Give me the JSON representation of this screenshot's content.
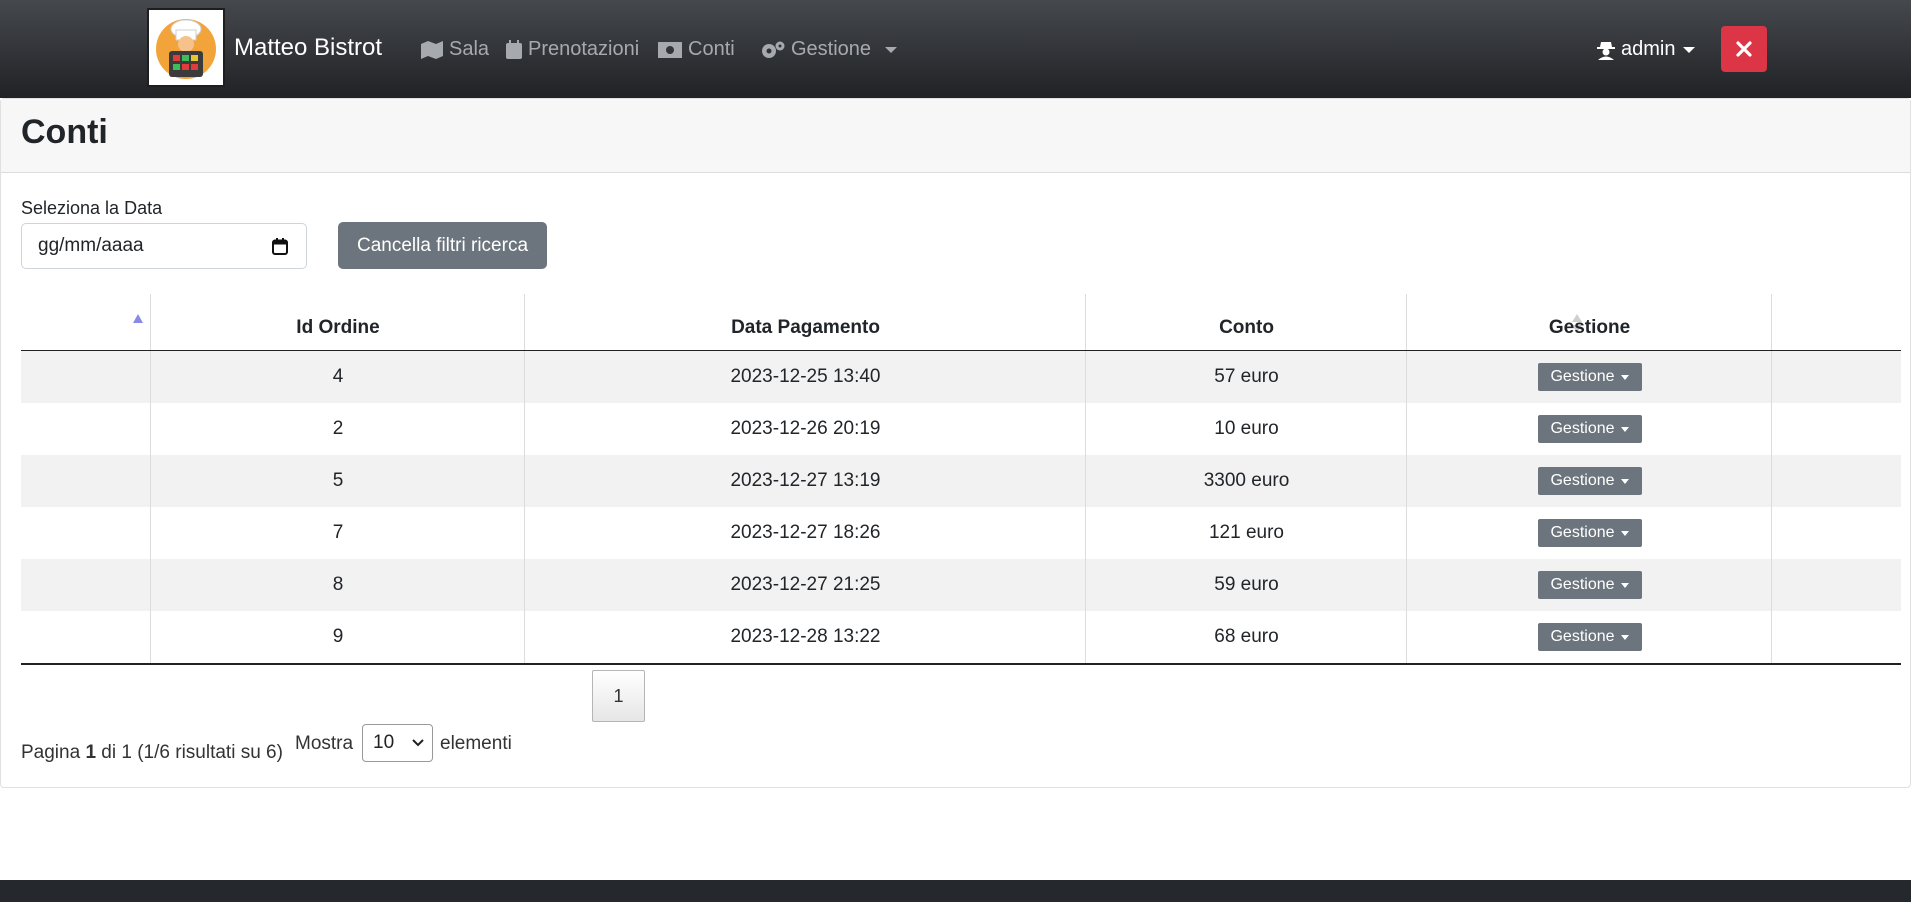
{
  "navbar": {
    "brand": "Matteo Bistrot",
    "links": [
      {
        "label": "Sala",
        "icon": "map-icon"
      },
      {
        "label": "Prenotazioni",
        "icon": "calendar-icon"
      },
      {
        "label": "Conti",
        "icon": "money-bill-icon"
      },
      {
        "label": "Gestione",
        "icon": "gears-icon"
      }
    ],
    "user": "admin",
    "close_symbol": "✕"
  },
  "page": {
    "title": "Conti"
  },
  "filters": {
    "date_label": "Seleziona la Data",
    "date_placeholder": "gg/mm/aaaa",
    "clear_button": "Cancella filtri ricerca"
  },
  "table": {
    "headers": [
      "",
      "Id Ordine",
      "Data Pagamento",
      "Conto",
      "Gestione",
      ""
    ],
    "rows": [
      {
        "id": "4",
        "date": "2023-12-25 13:40",
        "amount": "57 euro",
        "action": "Gestione"
      },
      {
        "id": "2",
        "date": "2023-12-26 20:19",
        "amount": "10 euro",
        "action": "Gestione"
      },
      {
        "id": "5",
        "date": "2023-12-27 13:19",
        "amount": "3300 euro",
        "action": "Gestione"
      },
      {
        "id": "7",
        "date": "2023-12-27 18:26",
        "amount": "121 euro",
        "action": "Gestione"
      },
      {
        "id": "8",
        "date": "2023-12-27 21:25",
        "amount": "59 euro",
        "action": "Gestione"
      },
      {
        "id": "9",
        "date": "2023-12-28 13:22",
        "amount": "68 euro",
        "action": "Gestione"
      }
    ]
  },
  "pagination": {
    "current_page_button": "1",
    "info_prefix": "Pagina ",
    "info_page": "1",
    "info_suffix": " di 1 (1/6 risultati su 6)",
    "show_label": "Mostra",
    "page_size": "10",
    "items_label": "elementi"
  },
  "colors": {
    "close_button": "#dc3545",
    "secondary_button": "#6c757d",
    "sort_active": "#8a8ae6"
  }
}
